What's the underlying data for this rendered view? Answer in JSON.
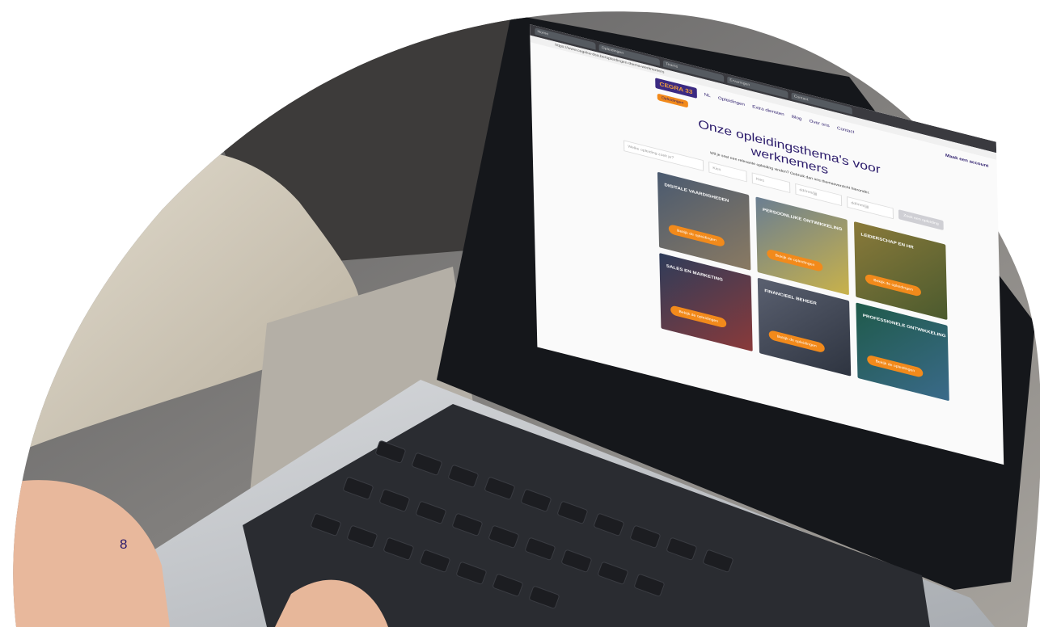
{
  "page_number": "8",
  "site": {
    "tabs": [
      "Home",
      "Opleidingen",
      "Teams",
      "Ervaringen",
      "Contact"
    ],
    "url": "https://www.cegeka-dsa.be/opleidingen-thema-werknemers",
    "logo": "CEGRA",
    "logo_suffix": "33",
    "language": "NL",
    "nav": [
      "Opleidingen",
      "Extra diensten",
      "Blog",
      "Over ons",
      "Contact"
    ],
    "account": "Maak een account",
    "badge": "Opleidingen",
    "title_line1": "Onze opleidingsthema's voor",
    "title_line2": "werknemers",
    "subtitle": "Wil je snel een relevante opleiding vinden? Gebruik dan ons themaoverzicht hieronder.",
    "filters": [
      "Welke opleiding zoek je?",
      "Kies",
      "Kies",
      "dd/mm/jjjj",
      "dd/mm/jjjj"
    ],
    "filter_button": "Zoek een opleiding",
    "cards": [
      {
        "title": "Digitale vaardigheden",
        "button": "Bekijk de opleidingen"
      },
      {
        "title": "Persoonlijke ontwikkeling",
        "button": "Bekijk de opleidingen"
      },
      {
        "title": "Leiderschap en HR",
        "button": "Bekijk de opleidingen"
      },
      {
        "title": "Sales en marketing",
        "button": "Bekijk de opleidingen"
      },
      {
        "title": "Financieel beheer",
        "button": "Bekijk de opleidingen"
      },
      {
        "title": "Professionele ontwikkeling",
        "button": "Bekijk de opleidingen"
      }
    ]
  },
  "colors": {
    "brand_purple": "#2b1b6b",
    "brand_orange": "#f28a1b",
    "screen_bg": "#fafafa",
    "laptop_body": "#c9ccd1",
    "keys": "#1c1d21"
  }
}
